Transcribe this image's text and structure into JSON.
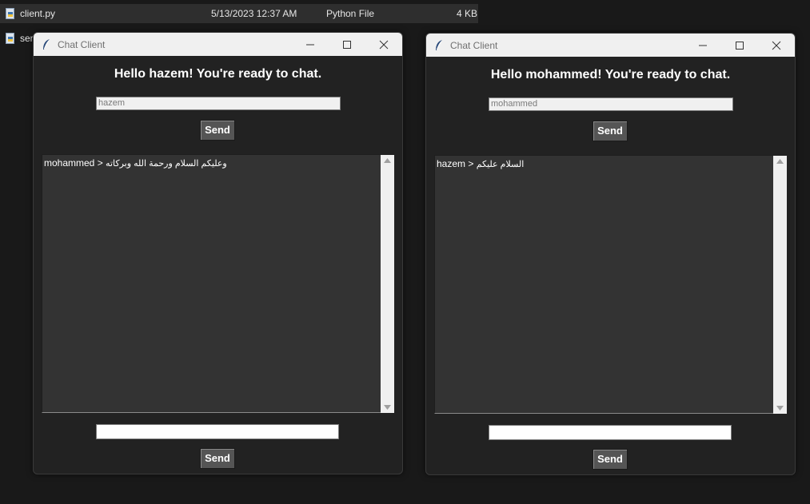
{
  "explorer": {
    "rows": [
      {
        "name": "client.py",
        "date": "5/13/2023 12:37 AM",
        "type": "Python File",
        "size": "4 KB"
      },
      {
        "name": "ser",
        "date": "",
        "type": "",
        "size": ""
      }
    ]
  },
  "windows": [
    {
      "title": "Chat Client",
      "greeting": "Hello hazem! You're ready to chat.",
      "name_value": "hazem",
      "send_top": "Send",
      "send_bottom": "Send",
      "message_sender": "mohammed > ",
      "message_text": "وعليكم السلام ورحمة الله وبركاته",
      "input_value": ""
    },
    {
      "title": "Chat Client",
      "greeting": "Hello mohammed! You're ready to chat.",
      "name_value": "mohammed",
      "send_top": "Send",
      "send_bottom": "Send",
      "message_sender": "hazem > ",
      "message_text": "السلام عليكم",
      "input_value": ""
    }
  ],
  "icons": {
    "file": "python-file-icon",
    "app": "tk-feather-icon",
    "minimize": "minimize-icon",
    "maximize": "maximize-icon",
    "close": "close-icon",
    "scroll_up": "scroll-up-arrow-icon",
    "scroll_down": "scroll-down-arrow-icon"
  },
  "colors": {
    "window_bg": "#222222",
    "chat_bg": "#333333",
    "button_bg": "#555555",
    "titlebar_bg": "#f0f0f0",
    "desktop_bg": "#191919"
  }
}
